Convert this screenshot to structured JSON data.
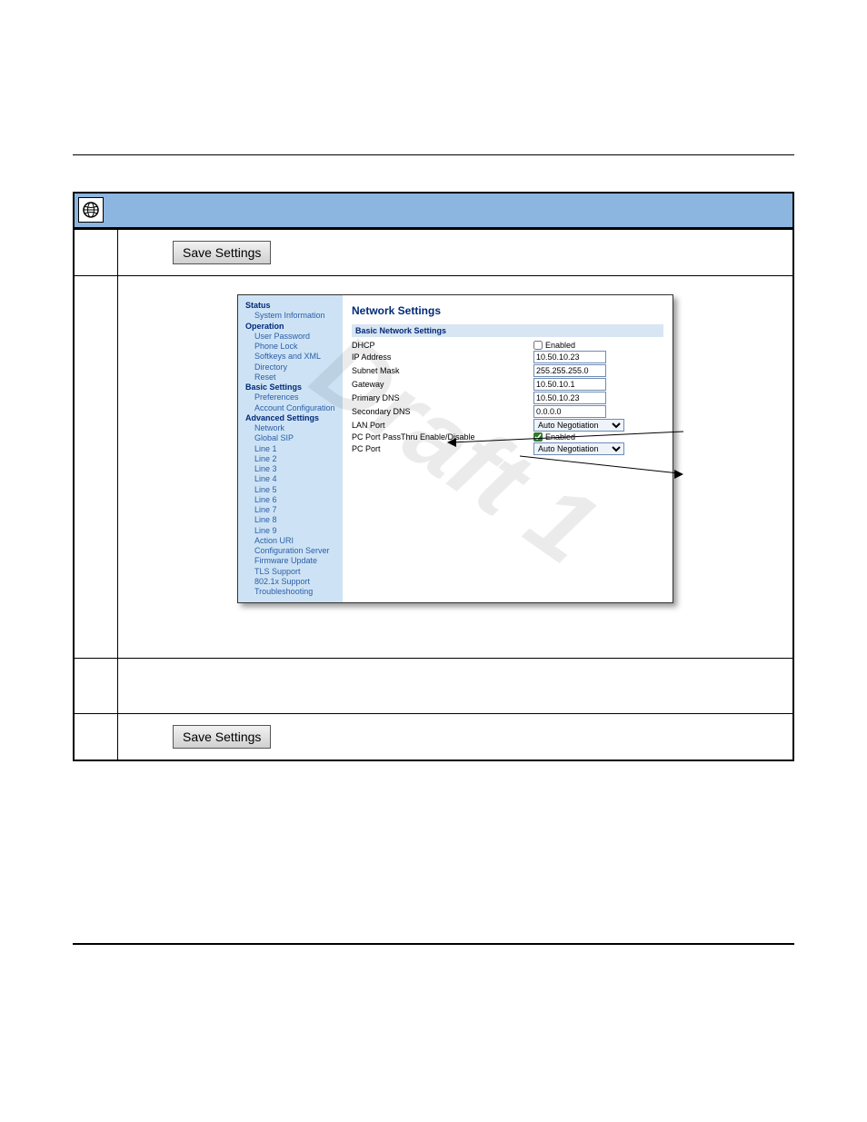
{
  "watermark": "Draft 1",
  "save_button_label": "Save Settings",
  "sidebar": {
    "status_head": "Status",
    "status_items": [
      "System Information"
    ],
    "operation_head": "Operation",
    "operation_items": [
      "User Password",
      "Phone Lock",
      "Softkeys and XML",
      "Directory",
      "Reset"
    ],
    "basic_head": "Basic Settings",
    "basic_items": [
      "Preferences",
      "Account Configuration"
    ],
    "adv_head": "Advanced Settings",
    "adv_items": [
      "Network",
      "Global SIP",
      "Line 1",
      "Line 2",
      "Line 3",
      "Line 4",
      "Line 5",
      "Line 6",
      "Line 7",
      "Line 8",
      "Line 9",
      "Action URI",
      "Configuration Server",
      "Firmware Update",
      "TLS Support",
      "802.1x Support",
      "Troubleshooting"
    ]
  },
  "content": {
    "title": "Network Settings",
    "subsection": "Basic Network Settings",
    "rows": {
      "dhcp_label": "DHCP",
      "dhcp_enabled_label": "Enabled",
      "ip_label": "IP Address",
      "ip_value": "10.50.10.23",
      "subnet_label": "Subnet Mask",
      "subnet_value": "255.255.255.0",
      "gateway_label": "Gateway",
      "gateway_value": "10.50.10.1",
      "pdns_label": "Primary DNS",
      "pdns_value": "10.50.10.23",
      "sdns_label": "Secondary DNS",
      "sdns_value": "0.0.0.0",
      "lan_label": "LAN Port",
      "lan_value": "Auto Negotiation",
      "pcpass_label": "PC Port PassThru Enable/Disable",
      "pcpass_enabled_label": "Enabled",
      "pcport_label": "PC Port",
      "pcport_value": "Auto Negotiation"
    }
  }
}
